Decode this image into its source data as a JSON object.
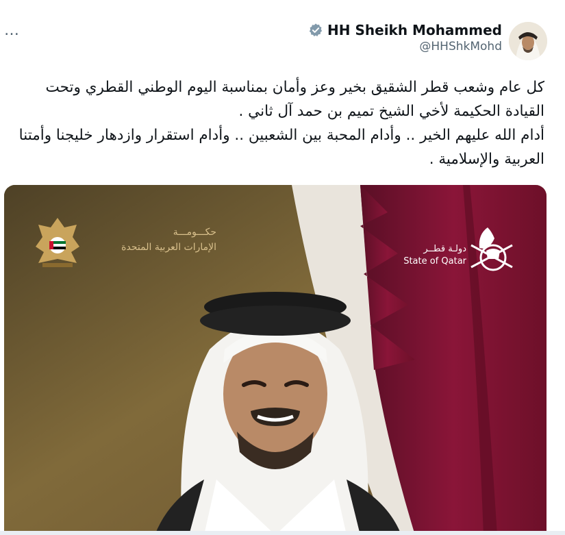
{
  "more_label": "…",
  "author": {
    "display_name": "HH Sheikh Mohammed",
    "handle": "@HHShkMohd"
  },
  "tweet": {
    "text": "كل عام وشعب قطر الشقيق بخير وعز وأمان بمناسبة اليوم الوطني القطري وتحت القيادة الحكيمة لأخي الشيخ تميم بن حمد آل ثاني .\nأدام الله عليهم الخير .. وأدام المحبة بين الشعبين .. وأدام استقرار وازدهار خليجنا وأمتنا العربية والإسلامية ."
  },
  "media": {
    "uae_line1": "حكـــومـــة",
    "uae_line2": "الإمارات العربية المتحدة",
    "qatar_ar": "دولـة قطــر",
    "qatar_en": "State of Qatar"
  },
  "colors": {
    "gold_bg": "#7a6334",
    "maroon": "#8a1538",
    "verified_gray": "#829aab"
  },
  "icons": [
    "more-icon",
    "verified-badge-icon",
    "uae-emblem-icon",
    "qatar-emblem-icon"
  ]
}
